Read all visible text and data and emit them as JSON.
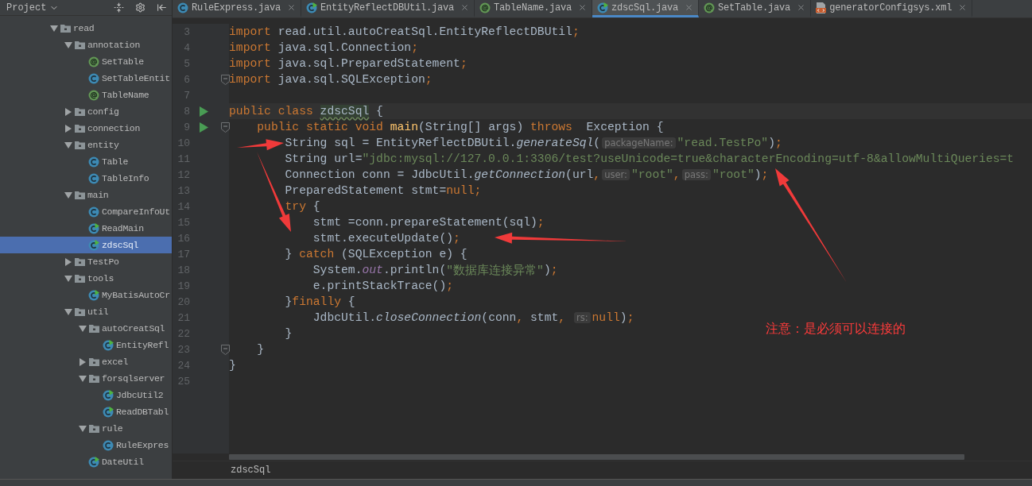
{
  "sidebar": {
    "title": "Project",
    "tree": [
      {
        "label": "read",
        "kind": "folder",
        "expanded": true,
        "children": [
          {
            "label": "annotation",
            "kind": "folder",
            "expanded": true,
            "children": [
              {
                "label": "SetTable",
                "kind": "annotation"
              },
              {
                "label": "SetTableEntit",
                "kind": "class"
              },
              {
                "label": "TableName",
                "kind": "annotation"
              }
            ]
          },
          {
            "label": "config",
            "kind": "folder",
            "expanded": false
          },
          {
            "label": "connection",
            "kind": "folder",
            "expanded": false
          },
          {
            "label": "entity",
            "kind": "folder",
            "expanded": true,
            "children": [
              {
                "label": "Table",
                "kind": "class"
              },
              {
                "label": "TableInfo",
                "kind": "class"
              }
            ]
          },
          {
            "label": "main",
            "kind": "folder",
            "expanded": true,
            "children": [
              {
                "label": "CompareInfoUt",
                "kind": "class"
              },
              {
                "label": "ReadMain",
                "kind": "runnable"
              },
              {
                "label": "zdscSql",
                "kind": "runnable",
                "selected": true
              }
            ]
          },
          {
            "label": "TestPo",
            "kind": "folder",
            "expanded": false
          },
          {
            "label": "tools",
            "kind": "folder",
            "expanded": true,
            "children": [
              {
                "label": "MyBatisAutoCr",
                "kind": "runnable"
              }
            ]
          },
          {
            "label": "util",
            "kind": "folder",
            "expanded": true,
            "children": [
              {
                "label": "autoCreatSql",
                "kind": "folder",
                "expanded": true,
                "children": [
                  {
                    "label": "EntityRefl",
                    "kind": "runnable"
                  }
                ]
              },
              {
                "label": "excel",
                "kind": "folder",
                "expanded": false
              },
              {
                "label": "forsqlserver",
                "kind": "folder",
                "expanded": true,
                "children": [
                  {
                    "label": "JdbcUtil2",
                    "kind": "runnable"
                  },
                  {
                    "label": "ReadDBTabl",
                    "kind": "runnable"
                  }
                ]
              },
              {
                "label": "rule",
                "kind": "folder",
                "expanded": true,
                "children": [
                  {
                    "label": "RuleExpres",
                    "kind": "class"
                  }
                ]
              },
              {
                "label": "DateUtil",
                "kind": "runnable"
              }
            ]
          }
        ]
      }
    ]
  },
  "tabs": [
    {
      "label": "RuleExpress.java",
      "kind": "class",
      "selected": false
    },
    {
      "label": "EntityReflectDBUtil.java",
      "kind": "runnable",
      "selected": false
    },
    {
      "label": "TableName.java",
      "kind": "annotation",
      "selected": false
    },
    {
      "label": "zdscSql.java",
      "kind": "runnable",
      "selected": true
    },
    {
      "label": "SetTable.java",
      "kind": "annotation",
      "selected": false
    },
    {
      "label": "generatorConfigsys.xml",
      "kind": "xml",
      "selected": false
    }
  ],
  "editor": {
    "lines": [
      {
        "number": "3",
        "tokens": [
          {
            "kind": "kw",
            "text": "import "
          },
          {
            "kind": "pl",
            "text": "read.util.autoCreatSql.EntityReflectDBUtil"
          },
          {
            "kind": "kw",
            "text": ";"
          }
        ]
      },
      {
        "number": "4",
        "tokens": [
          {
            "kind": "kw",
            "text": "import "
          },
          {
            "kind": "pl",
            "text": "java.sql.Connection"
          },
          {
            "kind": "kw",
            "text": ";"
          }
        ]
      },
      {
        "number": "5",
        "tokens": [
          {
            "kind": "kw",
            "text": "import "
          },
          {
            "kind": "pl",
            "text": "java.sql.PreparedStatement"
          },
          {
            "kind": "kw",
            "text": ";"
          }
        ]
      },
      {
        "number": "6",
        "fold": true,
        "tokens": [
          {
            "kind": "kw",
            "text": "import "
          },
          {
            "kind": "pl",
            "text": "java.sql.SQLException"
          },
          {
            "kind": "kw",
            "text": ";"
          }
        ]
      },
      {
        "number": "7"
      },
      {
        "number": "8",
        "run": true,
        "current": true,
        "tokens": [
          {
            "kind": "kw",
            "text": "public class "
          },
          {
            "kind": "decl",
            "text": "zdscSql"
          },
          {
            "kind": "pl",
            "text": " {"
          }
        ]
      },
      {
        "number": "9",
        "run": true,
        "fold": true,
        "tokens": [
          {
            "kind": "kw",
            "text": "    public static void "
          },
          {
            "kind": "fn",
            "text": "main"
          },
          {
            "kind": "pl",
            "text": "(String[] args) "
          },
          {
            "kind": "kw",
            "text": "throws"
          },
          {
            "kind": "pl",
            "text": "  Exception {"
          }
        ]
      },
      {
        "number": "10",
        "tokens": [
          {
            "kind": "pl",
            "text": "        String sql = EntityReflectDBUtil."
          },
          {
            "kind": "it",
            "text": "generateSql"
          },
          {
            "kind": "pl",
            "text": "("
          },
          {
            "kind": "hint",
            "text": "packageName:"
          },
          {
            "kind": "str",
            "text": "\"read.TestPo\""
          },
          {
            "kind": "pl",
            "text": ")"
          },
          {
            "kind": "kw",
            "text": ";"
          }
        ]
      },
      {
        "number": "11",
        "tokens": [
          {
            "kind": "pl",
            "text": "        String url="
          },
          {
            "kind": "str",
            "text": "\"jdbc:mysql://127.0.0.1:3306/test?useUnicode=true&characterEncoding=utf-8&allowMultiQueries=t"
          }
        ]
      },
      {
        "number": "12",
        "tokens": [
          {
            "kind": "pl",
            "text": "        Connection conn = JdbcUtil."
          },
          {
            "kind": "it",
            "text": "getConnection"
          },
          {
            "kind": "pl",
            "text": "(url"
          },
          {
            "kind": "kw",
            "text": ","
          },
          {
            "kind": "hint",
            "text": "user:"
          },
          {
            "kind": "str",
            "text": "\"root\""
          },
          {
            "kind": "kw",
            "text": ","
          },
          {
            "kind": "hint",
            "text": "pass:"
          },
          {
            "kind": "str",
            "text": "\"root\""
          },
          {
            "kind": "pl",
            "text": ")"
          },
          {
            "kind": "kw",
            "text": ";"
          }
        ]
      },
      {
        "number": "13",
        "tokens": [
          {
            "kind": "pl",
            "text": "        PreparedStatement stmt="
          },
          {
            "kind": "kw",
            "text": "null;"
          }
        ]
      },
      {
        "number": "14",
        "tokens": [
          {
            "kind": "kw",
            "text": "        try"
          },
          {
            "kind": "pl",
            "text": " {"
          }
        ]
      },
      {
        "number": "15",
        "tokens": [
          {
            "kind": "pl",
            "text": "            stmt =conn.prepareStatement(sql)"
          },
          {
            "kind": "kw",
            "text": ";"
          }
        ]
      },
      {
        "number": "16",
        "tokens": [
          {
            "kind": "pl",
            "text": "            stmt.executeUpdate()"
          },
          {
            "kind": "kw",
            "text": ";"
          }
        ]
      },
      {
        "number": "17",
        "tokens": [
          {
            "kind": "pl",
            "text": "        } "
          },
          {
            "kind": "kw",
            "text": "catch"
          },
          {
            "kind": "pl",
            "text": " (SQLException e) {"
          }
        ]
      },
      {
        "number": "18",
        "tokens": [
          {
            "kind": "pl",
            "text": "            System."
          },
          {
            "kind": "st",
            "text": "out"
          },
          {
            "kind": "pl",
            "text": ".println("
          },
          {
            "kind": "str",
            "text": "\"数据库连接异常\""
          },
          {
            "kind": "pl",
            "text": ")"
          },
          {
            "kind": "kw",
            "text": ";"
          }
        ]
      },
      {
        "number": "19",
        "tokens": [
          {
            "kind": "pl",
            "text": "            e.printStackTrace()"
          },
          {
            "kind": "kw",
            "text": ";"
          }
        ]
      },
      {
        "number": "20",
        "tokens": [
          {
            "kind": "pl",
            "text": "        }"
          },
          {
            "kind": "kw",
            "text": "finally"
          },
          {
            "kind": "pl",
            "text": " {"
          }
        ]
      },
      {
        "number": "21",
        "tokens": [
          {
            "kind": "pl",
            "text": "            JdbcUtil."
          },
          {
            "kind": "it",
            "text": "closeConnection"
          },
          {
            "kind": "pl",
            "text": "(conn"
          },
          {
            "kind": "kw",
            "text": ","
          },
          {
            "kind": "pl",
            "text": " stmt"
          },
          {
            "kind": "kw",
            "text": ", "
          },
          {
            "kind": "hint",
            "text": "rs:"
          },
          {
            "kind": "kw",
            "text": "null"
          },
          {
            "kind": "pl",
            "text": ")"
          },
          {
            "kind": "kw",
            "text": ";"
          }
        ]
      },
      {
        "number": "22",
        "tokens": [
          {
            "kind": "pl",
            "text": "        }"
          }
        ]
      },
      {
        "number": "23",
        "fold": true,
        "tokens": [
          {
            "kind": "pl",
            "text": "    }"
          }
        ]
      },
      {
        "number": "24",
        "tokens": [
          {
            "kind": "pl",
            "text": "}"
          }
        ]
      },
      {
        "number": "25"
      }
    ],
    "breadcrumb": "zdscSql"
  },
  "annotation": {
    "note": "注意：是必须可以连接的"
  }
}
